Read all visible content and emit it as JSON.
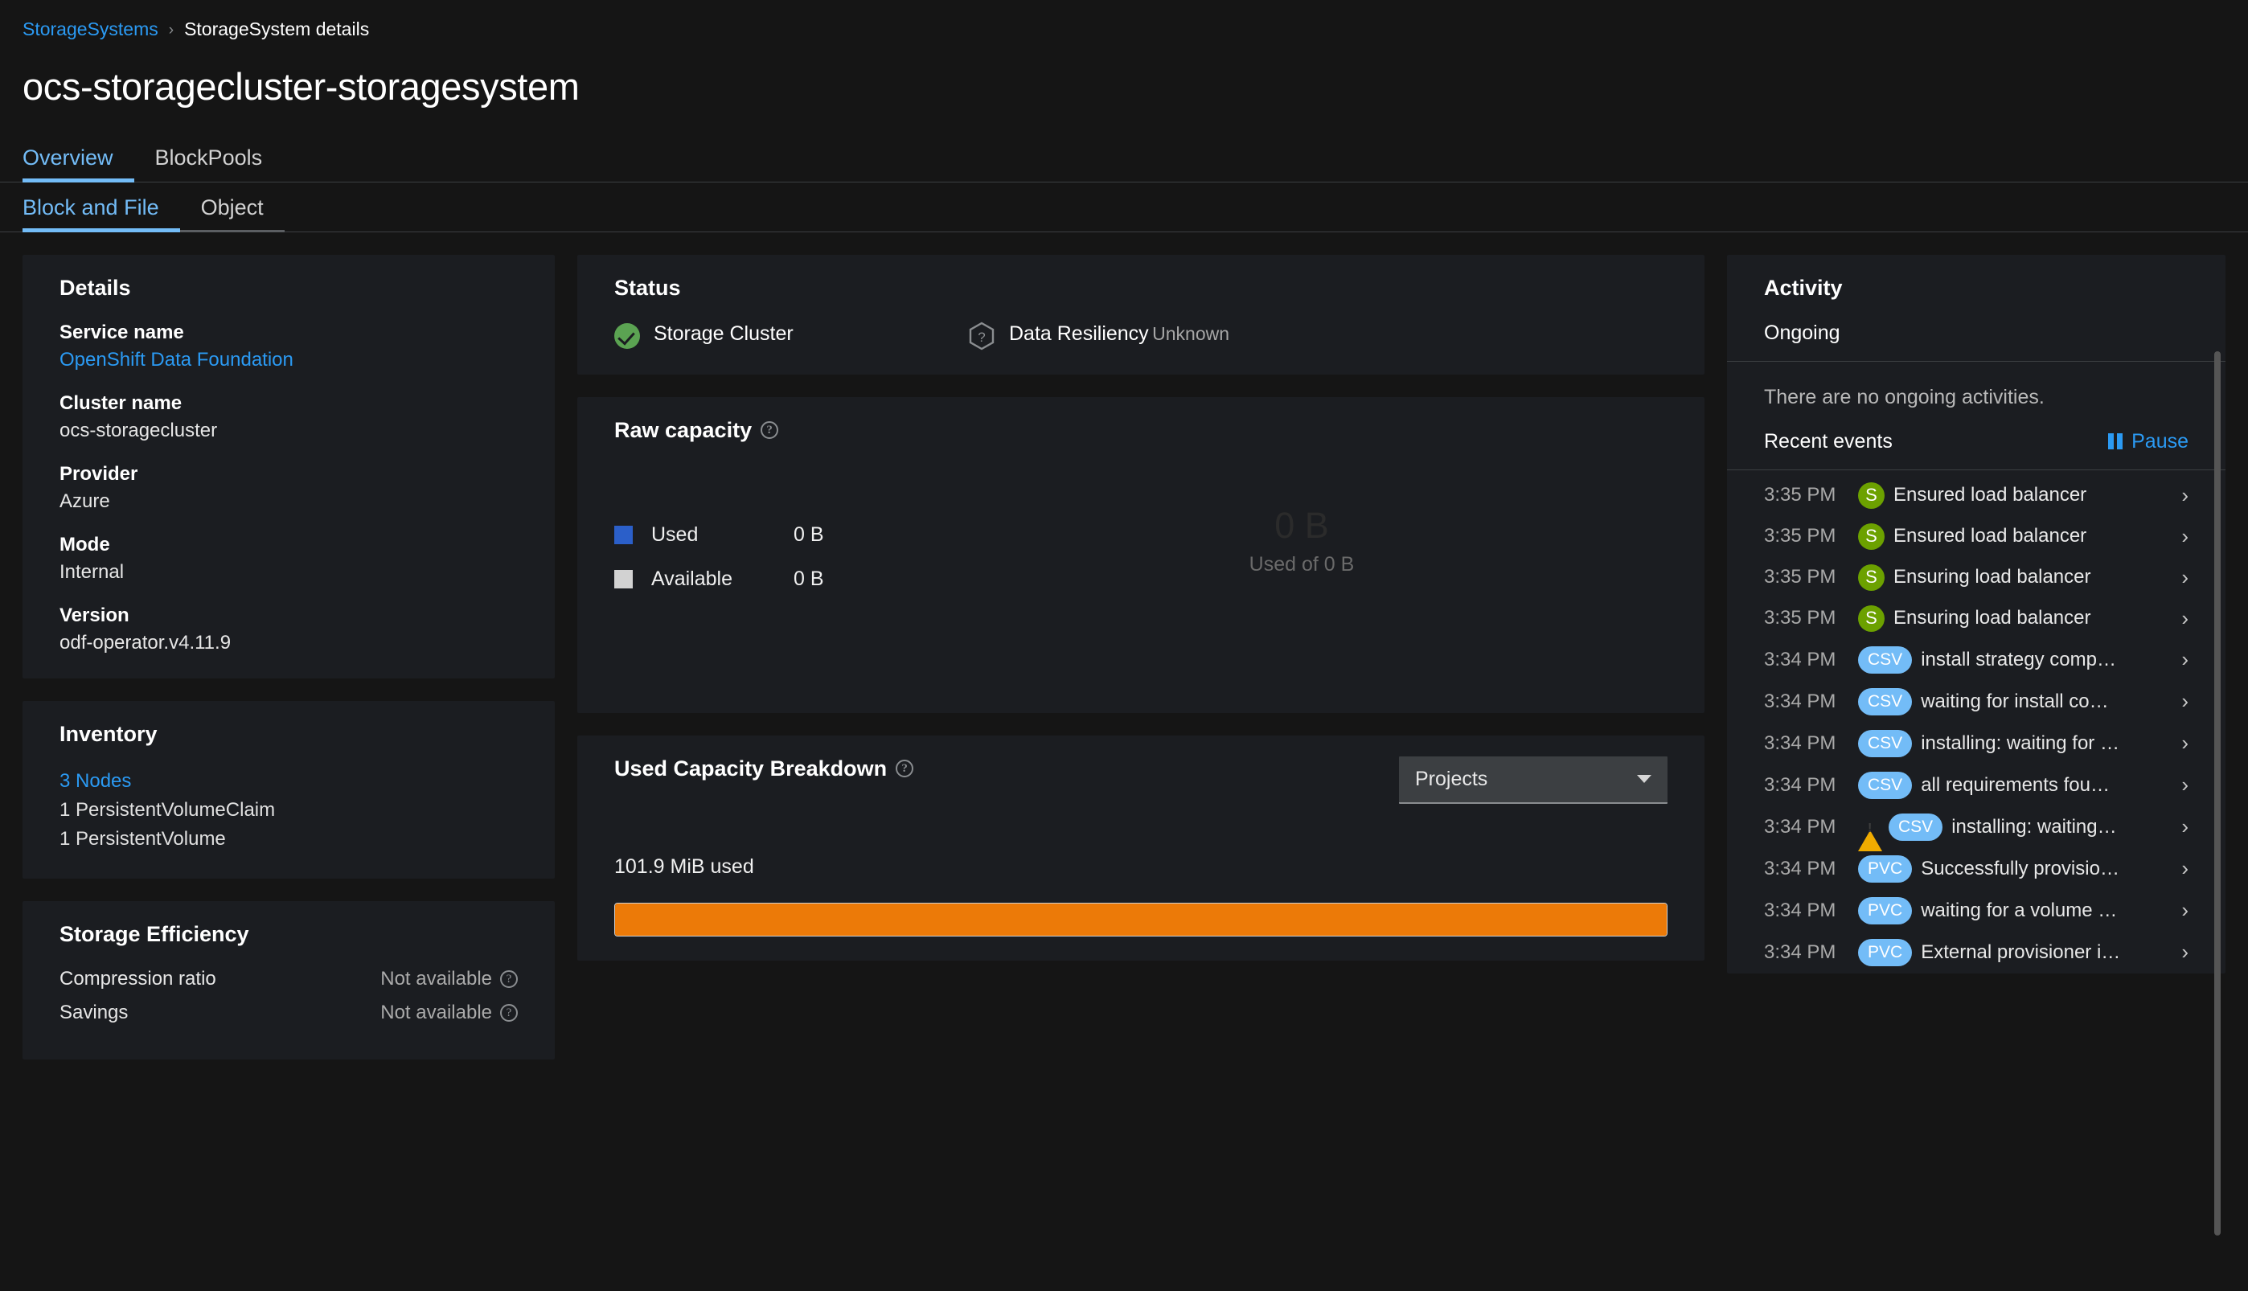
{
  "breadcrumb": {
    "parent": "StorageSystems",
    "separator": "›",
    "current": "StorageSystem details"
  },
  "page_title": "ocs-storagecluster-storagesystem",
  "primary_tabs": [
    {
      "label": "Overview",
      "active": true
    },
    {
      "label": "BlockPools",
      "active": false
    }
  ],
  "secondary_tabs": [
    {
      "label": "Block and File",
      "active": true
    },
    {
      "label": "Object",
      "active": false
    }
  ],
  "details": {
    "title": "Details",
    "items": [
      {
        "label": "Service name",
        "value": "OpenShift Data Foundation",
        "is_link": true
      },
      {
        "label": "Cluster name",
        "value": "ocs-storagecluster",
        "is_link": false
      },
      {
        "label": "Provider",
        "value": "Azure",
        "is_link": false
      },
      {
        "label": "Mode",
        "value": "Internal",
        "is_link": false
      },
      {
        "label": "Version",
        "value": "odf-operator.v4.11.9",
        "is_link": false
      }
    ]
  },
  "inventory": {
    "title": "Inventory",
    "nodes": "3 Nodes",
    "pvc": "1 PersistentVolumeClaim",
    "pv": "1 PersistentVolume"
  },
  "storage_efficiency": {
    "title": "Storage Efficiency",
    "rows": [
      {
        "label": "Compression ratio",
        "value": "Not available"
      },
      {
        "label": "Savings",
        "value": "Not available"
      }
    ]
  },
  "status": {
    "title": "Status",
    "items": [
      {
        "name": "Storage Cluster",
        "sub": "",
        "icon": "check-circle-icon",
        "color": "#5ba352"
      },
      {
        "name": "Data Resiliency",
        "sub": "Unknown",
        "icon": "question-hexagon-icon",
        "color": "#8a8d90"
      }
    ]
  },
  "raw_capacity": {
    "title": "Raw capacity",
    "legend": [
      {
        "label": "Used",
        "value": "0 B",
        "color": "#2b5fc9"
      },
      {
        "label": "Available",
        "value": "0 B",
        "color": "#d2d2d2"
      }
    ],
    "donut_center": "0 B",
    "donut_sub": "Used of 0 B"
  },
  "used_capacity_breakdown": {
    "title": "Used Capacity Breakdown",
    "dropdown_value": "Projects",
    "used_label": "101.9 MiB used",
    "bar_color": "#ec7a08",
    "bar_percent": 100
  },
  "activity": {
    "title": "Activity",
    "ongoing_label": "Ongoing",
    "no_ongoing_text": "There are no ongoing activities.",
    "recent_events_label": "Recent events",
    "pause_label": "Pause",
    "events": [
      {
        "time": "3:35 PM",
        "badge": "S",
        "badge_type": "green",
        "warning": false,
        "text": "Ensured load balancer"
      },
      {
        "time": "3:35 PM",
        "badge": "S",
        "badge_type": "green",
        "warning": false,
        "text": "Ensured load balancer"
      },
      {
        "time": "3:35 PM",
        "badge": "S",
        "badge_type": "green",
        "warning": false,
        "text": "Ensuring load balancer"
      },
      {
        "time": "3:35 PM",
        "badge": "S",
        "badge_type": "green",
        "warning": false,
        "text": "Ensuring load balancer"
      },
      {
        "time": "3:34 PM",
        "badge": "CSV",
        "badge_type": "blue",
        "warning": false,
        "text": "install strategy comp…"
      },
      {
        "time": "3:34 PM",
        "badge": "CSV",
        "badge_type": "blue",
        "warning": false,
        "text": "waiting for install co…"
      },
      {
        "time": "3:34 PM",
        "badge": "CSV",
        "badge_type": "blue",
        "warning": false,
        "text": "installing: waiting for …"
      },
      {
        "time": "3:34 PM",
        "badge": "CSV",
        "badge_type": "blue",
        "warning": false,
        "text": "all requirements fou…"
      },
      {
        "time": "3:34 PM",
        "badge": "CSV",
        "badge_type": "blue",
        "warning": true,
        "text": "installing: waiting…"
      },
      {
        "time": "3:34 PM",
        "badge": "PVC",
        "badge_type": "blue",
        "warning": false,
        "text": "Successfully provisio…"
      },
      {
        "time": "3:34 PM",
        "badge": "PVC",
        "badge_type": "blue",
        "warning": false,
        "text": "waiting for a volume …"
      },
      {
        "time": "3:34 PM",
        "badge": "PVC",
        "badge_type": "blue",
        "warning": false,
        "text": "External provisioner i…"
      }
    ]
  }
}
